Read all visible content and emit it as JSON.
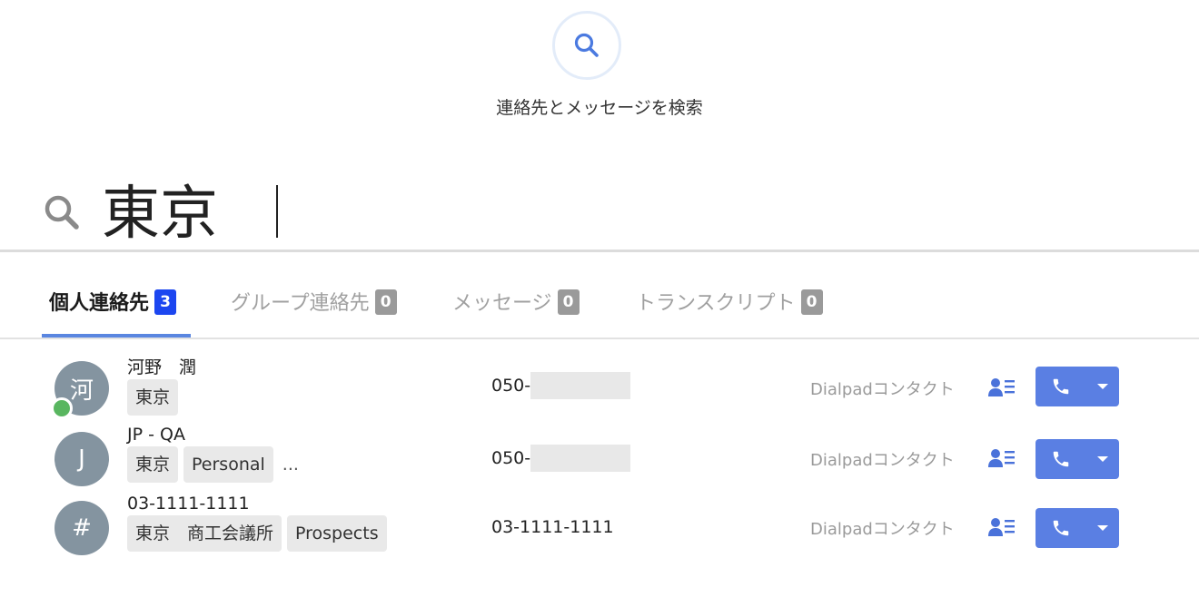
{
  "hero": {
    "icon": "search-icon",
    "text": "連絡先とメッセージを検索"
  },
  "search": {
    "value": "東京"
  },
  "tabs": [
    {
      "label": "個人連絡先",
      "count": "3"
    },
    {
      "label": "グループ連絡先",
      "count": "0"
    },
    {
      "label": "メッセージ",
      "count": "0"
    },
    {
      "label": "トランスクリプト",
      "count": "0"
    }
  ],
  "contacts": [
    {
      "avatar": "河",
      "name": "河野　潤",
      "tags": [
        "東京"
      ],
      "more": "",
      "phone": "050-",
      "source": "Dialpadコンタクト"
    },
    {
      "avatar": "J",
      "name": "JP - QA",
      "tags": [
        "東京",
        "Personal"
      ],
      "more": "...",
      "phone": "050-",
      "source": "Dialpadコンタクト"
    },
    {
      "avatar": "#",
      "name": "03-1111-1111",
      "tags": [
        "東京　商工会議所",
        "Prospects"
      ],
      "more": "",
      "phone": "03-1111-1111",
      "source": "Dialpadコンタクト"
    }
  ],
  "colors": {
    "accent": "#5a7fe3",
    "active_badge": "#1c46f0",
    "presence": "#59b660",
    "avatar": "#8494a0"
  }
}
